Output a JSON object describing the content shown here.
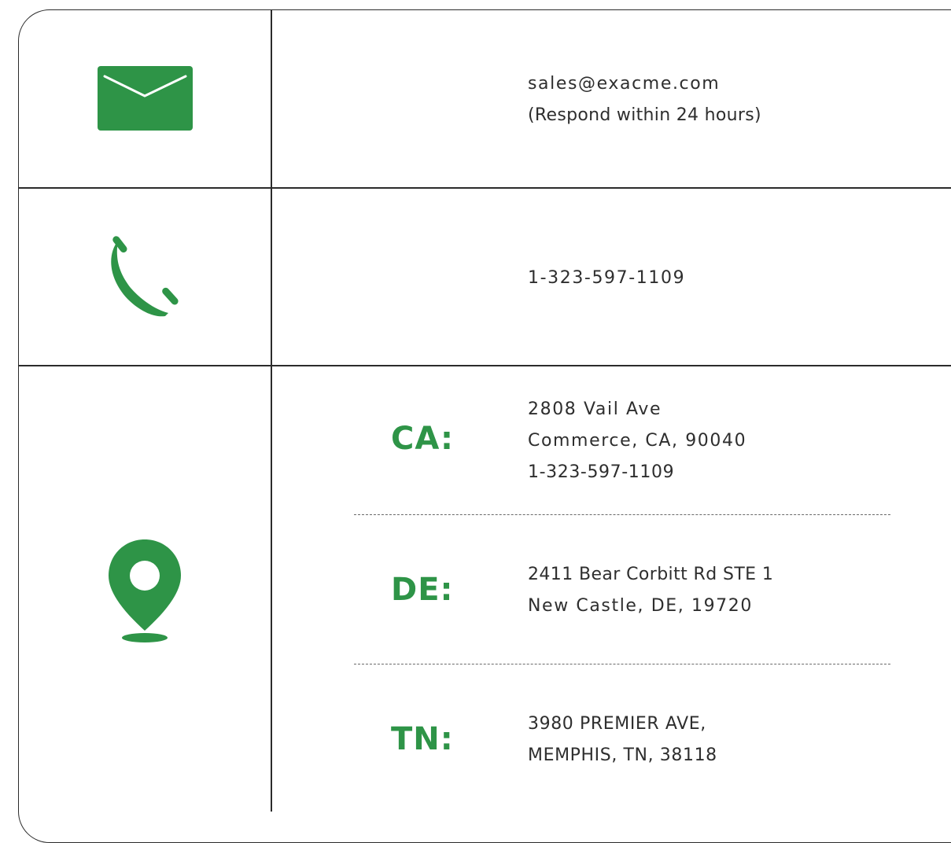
{
  "accent_color": "#2e9447",
  "rows": [
    {
      "icon": "email-icon",
      "lines": [
        "sales@exacme.com",
        "(Respond within 24 hours)"
      ]
    },
    {
      "icon": "phone-icon",
      "lines": [
        "1-323-597-1109"
      ]
    },
    {
      "icon": "map-pin-icon"
    }
  ],
  "locations": [
    {
      "state": "CA:",
      "lines": [
        "2808 Vail Ave",
        "Commerce, CA, 90040",
        "1-323-597-1109"
      ]
    },
    {
      "state": "DE:",
      "lines": [
        "2411 Bear Corbitt Rd STE 1",
        "New Castle, DE, 19720"
      ]
    },
    {
      "state": "TN:",
      "lines": [
        "3980 PREMIER AVE,",
        "MEMPHIS, TN, 38118"
      ]
    }
  ]
}
